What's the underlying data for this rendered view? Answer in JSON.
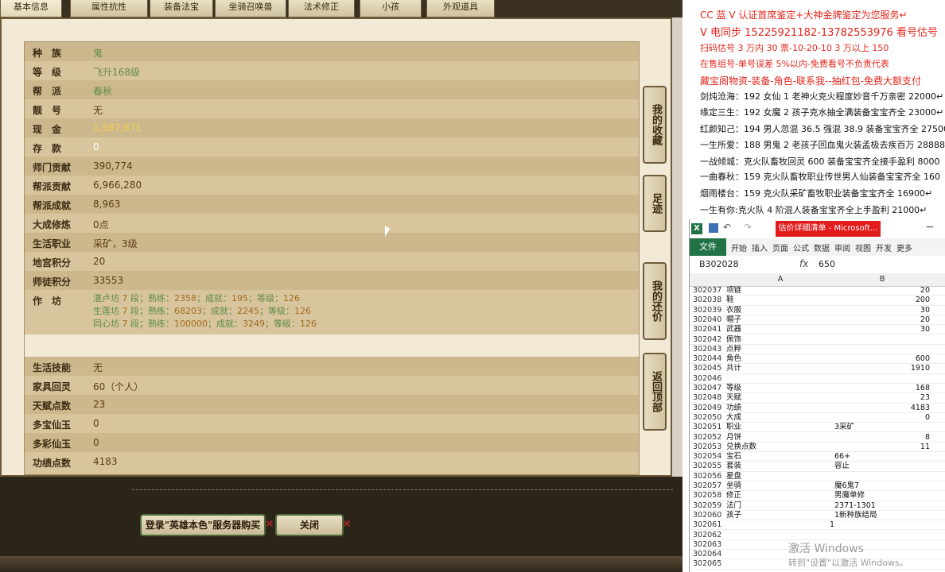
{
  "game": {
    "tabs": [
      "基本信息",
      "属性抗性",
      "装备法宝",
      "坐骑召唤兽",
      "法术修正",
      "小孩",
      "外观道具"
    ],
    "rows": [
      {
        "label": "种　族",
        "value": "鬼",
        "style": "green"
      },
      {
        "label": "等　级",
        "value": "飞升168级",
        "style": "green"
      },
      {
        "label": "帮　派",
        "value": "春秋",
        "style": "green"
      },
      {
        "label": "靓　号",
        "value": "无",
        "style": ""
      },
      {
        "label": "现　金",
        "value": "1,567,671",
        "style": "gold"
      },
      {
        "label": "存　款",
        "value": "0",
        "style": "white"
      },
      {
        "label": "师门贡献",
        "value": "390,774",
        "style": ""
      },
      {
        "label": "帮派贡献",
        "value": "6,966,280",
        "style": ""
      },
      {
        "label": "帮派成就",
        "value": "8,963",
        "style": ""
      },
      {
        "label": "大成修炼",
        "value": "0点",
        "style": ""
      },
      {
        "label": "生活职业",
        "value": "采矿，3级",
        "style": ""
      },
      {
        "label": "地宫积分",
        "value": "20",
        "style": ""
      },
      {
        "label": "师徒积分",
        "value": "33553",
        "style": ""
      }
    ],
    "workshop": {
      "label": "作　坊",
      "lines": [
        {
          "name": "湛卢坊",
          "level": "7",
          "seg": "段；熟练：",
          "skill": "2358",
          "a": "；成就：",
          "ach": "195",
          "b": "；等级：",
          "lv": "126"
        },
        {
          "name": "生莲坊",
          "level": "7",
          "seg": "段；熟练：",
          "skill": "68203",
          "a": "；成就：",
          "ach": "2245",
          "b": "；等级：",
          "lv": "126"
        },
        {
          "name": "同心坊",
          "level": "7",
          "seg": "段；熟练：",
          "skill": "100000",
          "a": "；成就：",
          "ach": "3249",
          "b": "；等级：",
          "lv": "126"
        }
      ]
    },
    "rows2": [
      {
        "label": "生活技能",
        "value": "无"
      },
      {
        "label": "家具回灵",
        "value": "60（个人）"
      },
      {
        "label": "天赋点数",
        "value": "23"
      },
      {
        "label": "多宝仙玉",
        "value": "0"
      },
      {
        "label": "多彩仙玉",
        "value": "0"
      },
      {
        "label": "功绩点数",
        "value": "4183"
      }
    ],
    "side_buttons": [
      "我的收藏",
      "足迹",
      "我的还价",
      "返回顶部"
    ],
    "buy_button": "登录\"英雄本色\"服务器购买",
    "close_button": "关闭"
  },
  "notes": [
    {
      "text": "CC 蓝 V 认证首席鉴定+大神金牌鉴定为您服务↵",
      "color": "#e0261c",
      "size": "12px"
    },
    {
      "text": "V 电同步 15225921182-13782553976 看号估号",
      "color": "#e0261c",
      "size": "13px"
    },
    {
      "text": "扫码估号 3 万内 30 票-10-20-10 3 万以上 150",
      "color": "#e0261c",
      "size": "11px"
    },
    {
      "text": "在售组号-单号误差 5%以内-免费看号不负责代表",
      "color": "#e0261c",
      "size": "11px"
    },
    {
      "text": "藏宝阁物资-装备-角色-联系我--抽红包-免费大额支付",
      "color": "#e0261c",
      "size": "12px"
    },
    {
      "text": "剑炖沧海：192 女仙 1 老神火克火程度妙音千万亲密 22000↵",
      "color": "#111",
      "size": "11px"
    },
    {
      "text": "缘定三生：192 女魔 2 孩子克水抽全满装备宝宝齐全 23000↵",
      "color": "#111",
      "size": "11px"
    },
    {
      "text": "红颜知己：194 男人忽混 36.5 强混 38.9 装备宝宝齐全 27500↵",
      "color": "#111",
      "size": "11px"
    },
    {
      "text": "一生所爱：188 男鬼 2 老孩子回血鬼火装孟极去疾百万 28888",
      "color": "#111",
      "size": "11px"
    },
    {
      "text": "一战倾城：克火队畜牧回灵 600 装备宝宝齐全接手盈利 8000",
      "color": "#111",
      "size": "11px"
    },
    {
      "text": "一曲春秋：159 克火队畜牧职业传世男人仙装备宝宝齐全 160",
      "color": "#111",
      "size": "11px"
    },
    {
      "text": "烟雨楼台：159 克火队采矿畜牧职业装备宝宝齐全 16900↵",
      "color": "#111",
      "size": "11px"
    },
    {
      "text": "一生有你:克火队 4 阶混人装备宝宝齐全上手盈利 21000↵",
      "color": "#111",
      "size": "11px"
    }
  ],
  "excel": {
    "window_title": "估价详细清单 - Microsoft...",
    "file_tab": "文件",
    "ribbon_tabs": [
      "开始",
      "插入",
      "页面",
      "公式",
      "数据",
      "审阅",
      "视图",
      "开发",
      "更多"
    ],
    "name_box": "B302028",
    "fx": "fx",
    "formula": "650",
    "col_a": "A",
    "col_b": "B",
    "rows": [
      {
        "n": "302037",
        "a": "项链",
        "b": "20",
        "num": true
      },
      {
        "n": "302038",
        "a": "鞋",
        "b": "200",
        "num": true
      },
      {
        "n": "302039",
        "a": "衣服",
        "b": "30",
        "num": true
      },
      {
        "n": "302040",
        "a": "帽子",
        "b": "20",
        "num": true
      },
      {
        "n": "302041",
        "a": "武器",
        "b": "30",
        "num": true
      },
      {
        "n": "302042",
        "a": "佩饰",
        "b": "",
        "num": true
      },
      {
        "n": "302043",
        "a": "点粹",
        "b": "",
        "num": true
      },
      {
        "n": "302044",
        "a": "角色",
        "b": "600",
        "num": true
      },
      {
        "n": "302045",
        "a": "共计",
        "b": "1910",
        "num": true
      },
      {
        "n": "302046",
        "a": "",
        "b": "",
        "num": true
      },
      {
        "n": "302047",
        "a": "等级",
        "b": "168",
        "num": true
      },
      {
        "n": "302048",
        "a": "天赋",
        "b": "23",
        "num": true
      },
      {
        "n": "302049",
        "a": "功绩",
        "b": "4183",
        "num": true
      },
      {
        "n": "302050",
        "a": "大成",
        "b": "0",
        "num": true
      },
      {
        "n": "302051",
        "a": "职业",
        "b": "3采矿",
        "num": false
      },
      {
        "n": "302052",
        "a": "月饼",
        "b": "8",
        "num": true
      },
      {
        "n": "302053",
        "a": "兑换点数",
        "b": "11",
        "num": true
      },
      {
        "n": "302054",
        "a": "宝石",
        "b": "66+",
        "num": false
      },
      {
        "n": "302055",
        "a": "套装",
        "b": "容止",
        "num": false
      },
      {
        "n": "302056",
        "a": "星盘",
        "b": "",
        "num": false
      },
      {
        "n": "302057",
        "a": "坐骑",
        "b": "魔6鬼7",
        "num": false
      },
      {
        "n": "302058",
        "a": "修正",
        "b": "男魔单修",
        "num": false
      },
      {
        "n": "302059",
        "a": "法门",
        "b": "2371-1301",
        "num": false
      },
      {
        "n": "302060",
        "a": "孩子",
        "b": "1新种族结局",
        "num": false
      },
      {
        "n": "302061",
        "a": "1",
        "b": "",
        "num": true
      },
      {
        "n": "302062",
        "a": "",
        "b": "",
        "num": true
      },
      {
        "n": "302063",
        "a": "",
        "b": "",
        "num": true
      },
      {
        "n": "302064",
        "a": "",
        "b": "",
        "num": true
      },
      {
        "n": "302065",
        "a": "",
        "b": "",
        "num": true
      }
    ],
    "watermark": "激活 Windows",
    "watermark_sub": "转到\"设置\"以激活 Windows。"
  },
  "colors": {
    "accent": "#217346",
    "title_red": "#e21c1c",
    "panel_bg": "#f2ead6",
    "row_dark": "#cdb88e",
    "row_light": "#d8c59e"
  }
}
